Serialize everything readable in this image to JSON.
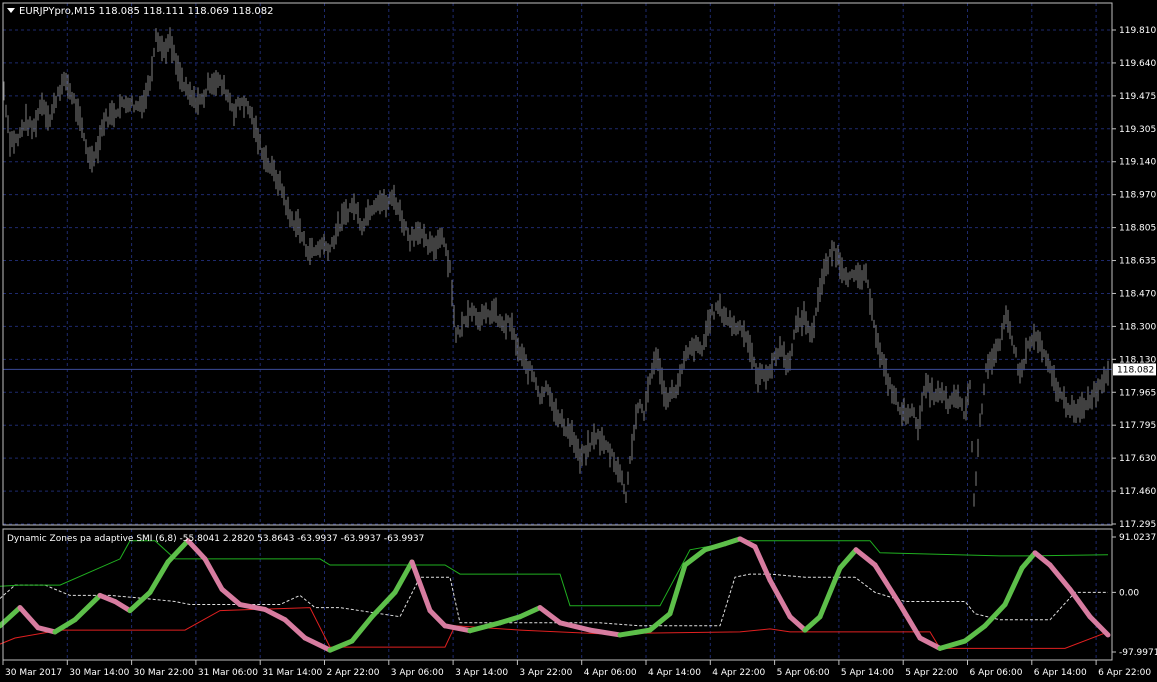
{
  "window": {
    "symbol_header": "EURJPYpro,M15  118.085 118.111 118.069 118.082",
    "indicator_header": "Dynamic Zones pa adaptive SMI (6,8) -55.8041 2.2820 53.8643 -63.9937 -63.9937 -63.9937"
  },
  "colors": {
    "background": "#000000",
    "grid": "#1e2a6e",
    "frame": "#c0c0c0",
    "price_bars": "#808080",
    "current_price_line": "#3b4b9a",
    "current_price_box": "#ffffff",
    "smi_up": "#5dbf4a",
    "smi_down": "#d77ca0",
    "zone_upper": "#20b020",
    "zone_lower": "#e02020",
    "zone_middle": "#e0e0e0"
  },
  "price_axis": {
    "labels": [
      "119.810",
      "119.640",
      "119.475",
      "119.305",
      "119.140",
      "118.970",
      "118.805",
      "118.635",
      "118.470",
      "118.300",
      "118.130",
      "117.965",
      "117.795",
      "117.630",
      "117.460",
      "117.295"
    ],
    "current_price": "118.082"
  },
  "indicator_axis": {
    "labels": [
      "91.0237",
      "0.00",
      "-97.9971"
    ]
  },
  "time_axis": {
    "labels": [
      "30 Mar 2017",
      "30 Mar 14:00",
      "30 Mar 22:00",
      "31 Mar 06:00",
      "31 Mar 14:00",
      "2 Apr 22:00",
      "3 Apr 06:00",
      "3 Apr 14:00",
      "3 Apr 22:00",
      "4 Apr 06:00",
      "4 Apr 14:00",
      "4 Apr 22:00",
      "5 Apr 06:00",
      "5 Apr 14:00",
      "5 Apr 22:00",
      "6 Apr 06:00",
      "6 Apr 14:00",
      "6 Apr 22:00"
    ]
  },
  "chart_data": [
    {
      "type": "bar",
      "title": "EURJPYpro,M15",
      "ylim": [
        117.295,
        119.81
      ],
      "current": 118.082,
      "anchors": [
        [
          0,
          119.55
        ],
        [
          4,
          119.5
        ],
        [
          10,
          119.25
        ],
        [
          18,
          119.25
        ],
        [
          25,
          119.35
        ],
        [
          33,
          119.3
        ],
        [
          42,
          119.45
        ],
        [
          50,
          119.35
        ],
        [
          58,
          119.5
        ],
        [
          66,
          119.55
        ],
        [
          74,
          119.45
        ],
        [
          82,
          119.3
        ],
        [
          90,
          119.15
        ],
        [
          97,
          119.2
        ],
        [
          104,
          119.35
        ],
        [
          112,
          119.38
        ],
        [
          120,
          119.42
        ],
        [
          128,
          119.45
        ],
        [
          136,
          119.42
        ],
        [
          144,
          119.45
        ],
        [
          150,
          119.55
        ],
        [
          156,
          119.8
        ],
        [
          163,
          119.7
        ],
        [
          170,
          119.75
        ],
        [
          178,
          119.6
        ],
        [
          186,
          119.5
        ],
        [
          194,
          119.45
        ],
        [
          202,
          119.45
        ],
        [
          210,
          119.55
        ],
        [
          218,
          119.55
        ],
        [
          226,
          119.5
        ],
        [
          234,
          119.4
        ],
        [
          242,
          119.45
        ],
        [
          250,
          119.4
        ],
        [
          258,
          119.25
        ],
        [
          266,
          119.15
        ],
        [
          274,
          119.08
        ],
        [
          282,
          119.0
        ],
        [
          290,
          118.85
        ],
        [
          298,
          118.82
        ],
        [
          306,
          118.7
        ],
        [
          314,
          118.68
        ],
        [
          322,
          118.72
        ],
        [
          330,
          118.7
        ],
        [
          338,
          118.8
        ],
        [
          346,
          118.88
        ],
        [
          354,
          118.92
        ],
        [
          362,
          118.82
        ],
        [
          370,
          118.9
        ],
        [
          378,
          118.95
        ],
        [
          386,
          118.92
        ],
        [
          394,
          118.96
        ],
        [
          402,
          118.85
        ],
        [
          410,
          118.75
        ],
        [
          418,
          118.8
        ],
        [
          426,
          118.72
        ],
        [
          434,
          118.7
        ],
        [
          442,
          118.78
        ],
        [
          450,
          118.6
        ],
        [
          456,
          118.25
        ],
        [
          462,
          118.3
        ],
        [
          470,
          118.4
        ],
        [
          478,
          118.35
        ],
        [
          486,
          118.35
        ],
        [
          494,
          118.38
        ],
        [
          502,
          118.3
        ],
        [
          510,
          118.32
        ],
        [
          518,
          118.18
        ],
        [
          526,
          118.1
        ],
        [
          534,
          118.05
        ],
        [
          540,
          117.95
        ],
        [
          548,
          118.0
        ],
        [
          556,
          117.85
        ],
        [
          564,
          117.8
        ],
        [
          572,
          117.75
        ],
        [
          580,
          117.62
        ],
        [
          588,
          117.68
        ],
        [
          596,
          117.75
        ],
        [
          604,
          117.7
        ],
        [
          612,
          117.65
        ],
        [
          620,
          117.55
        ],
        [
          626,
          117.45
        ],
        [
          632,
          117.7
        ],
        [
          638,
          117.9
        ],
        [
          644,
          117.85
        ],
        [
          650,
          118.05
        ],
        [
          658,
          118.15
        ],
        [
          664,
          117.95
        ],
        [
          670,
          117.95
        ],
        [
          678,
          118.0
        ],
        [
          686,
          118.15
        ],
        [
          694,
          118.2
        ],
        [
          702,
          118.18
        ],
        [
          710,
          118.35
        ],
        [
          718,
          118.4
        ],
        [
          726,
          118.35
        ],
        [
          734,
          118.3
        ],
        [
          742,
          118.3
        ],
        [
          750,
          118.2
        ],
        [
          756,
          118.05
        ],
        [
          764,
          118.05
        ],
        [
          772,
          118.1
        ],
        [
          780,
          118.2
        ],
        [
          788,
          118.1
        ],
        [
          796,
          118.3
        ],
        [
          804,
          118.35
        ],
        [
          812,
          118.25
        ],
        [
          818,
          118.45
        ],
        [
          826,
          118.6
        ],
        [
          834,
          118.7
        ],
        [
          842,
          118.6
        ],
        [
          850,
          118.55
        ],
        [
          858,
          118.55
        ],
        [
          866,
          118.55
        ],
        [
          872,
          118.4
        ],
        [
          878,
          118.2
        ],
        [
          886,
          118.05
        ],
        [
          894,
          117.95
        ],
        [
          902,
          117.85
        ],
        [
          910,
          117.88
        ],
        [
          918,
          117.8
        ],
        [
          926,
          118.0
        ],
        [
          934,
          117.95
        ],
        [
          942,
          117.95
        ],
        [
          950,
          117.9
        ],
        [
          958,
          117.95
        ],
        [
          964,
          117.85
        ],
        [
          970,
          118.0
        ],
        [
          974,
          117.4
        ],
        [
          978,
          117.7
        ],
        [
          986,
          118.1
        ],
        [
          994,
          118.15
        ],
        [
          1000,
          118.2
        ],
        [
          1006,
          118.35
        ],
        [
          1012,
          118.25
        ],
        [
          1020,
          118.05
        ],
        [
          1028,
          118.2
        ],
        [
          1036,
          118.25
        ],
        [
          1044,
          118.15
        ],
        [
          1052,
          118.05
        ],
        [
          1060,
          117.95
        ],
        [
          1068,
          117.9
        ],
        [
          1076,
          117.85
        ],
        [
          1084,
          117.9
        ],
        [
          1092,
          117.95
        ],
        [
          1100,
          118.0
        ],
        [
          1108,
          118.08
        ]
      ]
    },
    {
      "type": "line",
      "title": "Dynamic Zones pa adaptive SMI (6,8)",
      "ylim": [
        -97.9971,
        91.0237
      ],
      "series": [
        {
          "values": [
            [
              0,
              -55
            ],
            [
              20,
              -25
            ],
            [
              38,
              -58
            ],
            [
              55,
              -65
            ],
            [
              75,
              -45
            ],
            [
              100,
              -5
            ],
            [
              115,
              -15
            ],
            [
              130,
              -30
            ],
            [
              150,
              0
            ],
            [
              168,
              50
            ],
            [
              188,
              85
            ],
            [
              205,
              55
            ],
            [
              222,
              5
            ],
            [
              240,
              -20
            ],
            [
              265,
              -28
            ],
            [
              285,
              -45
            ],
            [
              305,
              -75
            ],
            [
              330,
              -95
            ],
            [
              352,
              -80
            ],
            [
              372,
              -40
            ],
            [
              395,
              0
            ],
            [
              412,
              50
            ],
            [
              430,
              -30
            ],
            [
              445,
              -55
            ],
            [
              470,
              -63
            ],
            [
              500,
              -50
            ],
            [
              520,
              -40
            ],
            [
              540,
              -25
            ],
            [
              560,
              -50
            ],
            [
              590,
              -62
            ],
            [
              620,
              -70
            ],
            [
              650,
              -62
            ],
            [
              670,
              -35
            ],
            [
              685,
              45
            ],
            [
              705,
              70
            ],
            [
              725,
              80
            ],
            [
              740,
              88
            ],
            [
              755,
              75
            ],
            [
              770,
              20
            ],
            [
              790,
              -40
            ],
            [
              805,
              -62
            ],
            [
              820,
              -40
            ],
            [
              840,
              40
            ],
            [
              856,
              70
            ],
            [
              875,
              45
            ],
            [
              900,
              -20
            ],
            [
              920,
              -75
            ],
            [
              940,
              -92
            ],
            [
              965,
              -80
            ],
            [
              985,
              -55
            ],
            [
              1005,
              -20
            ],
            [
              1022,
              40
            ],
            [
              1035,
              65
            ],
            [
              1050,
              45
            ],
            [
              1070,
              5
            ],
            [
              1090,
              -40
            ],
            [
              1108,
              -70
            ]
          ]
        },
        {
          "values": [
            [
              0,
              -85
            ],
            [
              15,
              -75
            ],
            [
              60,
              -62
            ],
            [
              185,
              -62
            ],
            [
              220,
              -30
            ],
            [
              310,
              -25
            ],
            [
              330,
              -90
            ],
            [
              445,
              -90
            ],
            [
              455,
              -55
            ],
            [
              520,
              -62
            ],
            [
              600,
              -68
            ],
            [
              740,
              -65
            ],
            [
              770,
              -60
            ],
            [
              790,
              -65
            ],
            [
              930,
              -65
            ],
            [
              940,
              -92
            ],
            [
              1065,
              -92
            ],
            [
              1108,
              -65
            ]
          ]
        },
        {
          "values": [
            [
              0,
              10
            ],
            [
              20,
              12
            ],
            [
              60,
              12
            ],
            [
              120,
              55
            ],
            [
              130,
              85
            ],
            [
              155,
              85
            ],
            [
              175,
              55
            ],
            [
              320,
              55
            ],
            [
              330,
              45
            ],
            [
              445,
              45
            ],
            [
              460,
              30
            ],
            [
              560,
              30
            ],
            [
              570,
              -22
            ],
            [
              660,
              -22
            ],
            [
              690,
              70
            ],
            [
              740,
              85
            ],
            [
              870,
              85
            ],
            [
              880,
              65
            ],
            [
              1000,
              60
            ],
            [
              1030,
              60
            ],
            [
              1108,
              62
            ]
          ]
        },
        {
          "values": [
            [
              0,
              -10
            ],
            [
              15,
              12
            ],
            [
              45,
              12
            ],
            [
              70,
              -5
            ],
            [
              110,
              -5
            ],
            [
              145,
              -10
            ],
            [
              175,
              -15
            ],
            [
              190,
              -20
            ],
            [
              280,
              -20
            ],
            [
              300,
              -5
            ],
            [
              315,
              -25
            ],
            [
              340,
              -25
            ],
            [
              400,
              -40
            ],
            [
              420,
              25
            ],
            [
              450,
              25
            ],
            [
              460,
              -50
            ],
            [
              600,
              -50
            ],
            [
              640,
              -55
            ],
            [
              700,
              -55
            ],
            [
              720,
              -55
            ],
            [
              735,
              25
            ],
            [
              750,
              30
            ],
            [
              770,
              30
            ],
            [
              805,
              25
            ],
            [
              855,
              25
            ],
            [
              875,
              0
            ],
            [
              905,
              -15
            ],
            [
              965,
              -15
            ],
            [
              975,
              -35
            ],
            [
              1000,
              -45
            ],
            [
              1050,
              -45
            ],
            [
              1075,
              0
            ],
            [
              1108,
              0
            ]
          ]
        }
      ]
    }
  ]
}
